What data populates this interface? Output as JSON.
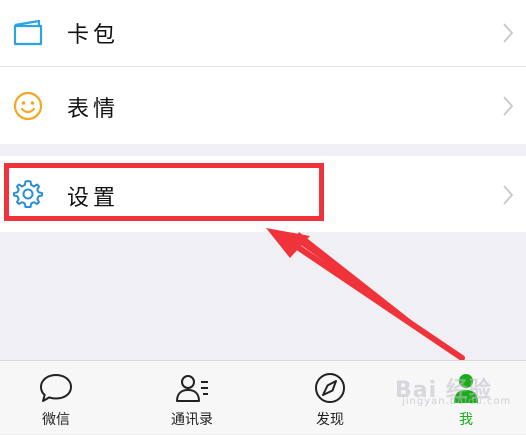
{
  "menu": {
    "items": [
      {
        "label": "卡包",
        "icon": "card-wallet-icon"
      },
      {
        "label": "表情",
        "icon": "smiley-icon"
      },
      {
        "label": "设置",
        "icon": "gear-icon"
      }
    ]
  },
  "tabbar": {
    "tabs": [
      {
        "label": "微信",
        "icon": "chat-bubble-icon",
        "active": false
      },
      {
        "label": "通讯录",
        "icon": "contacts-icon",
        "active": false
      },
      {
        "label": "发现",
        "icon": "compass-icon",
        "active": false
      },
      {
        "label": "我",
        "icon": "person-icon",
        "active": true
      }
    ]
  },
  "watermark": {
    "text": "Bai 经验",
    "sub": "jingyan.baidu.com"
  },
  "colors": {
    "accent_green": "#1aad19",
    "highlight_red": "#f0333a",
    "card_icon": "#2ba3e0",
    "smiley_icon": "#f5a623",
    "gear_icon": "#2c8fd6"
  }
}
